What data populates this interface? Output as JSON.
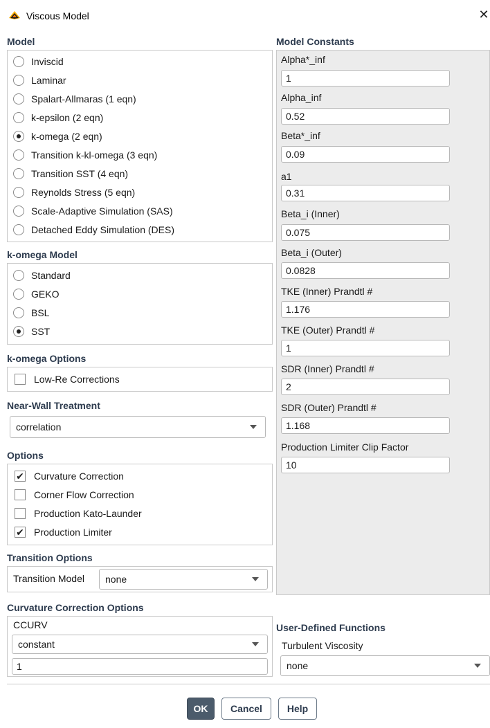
{
  "window": {
    "title": "Viscous Model",
    "close_symbol": "✕",
    "app_icon": "fluent-app-icon"
  },
  "model": {
    "heading": "Model",
    "options": [
      {
        "label": "Inviscid",
        "selected": false
      },
      {
        "label": "Laminar",
        "selected": false
      },
      {
        "label": "Spalart-Allmaras (1 eqn)",
        "selected": false
      },
      {
        "label": "k-epsilon (2 eqn)",
        "selected": false
      },
      {
        "label": "k-omega (2 eqn)",
        "selected": true
      },
      {
        "label": "Transition k-kl-omega (3 eqn)",
        "selected": false
      },
      {
        "label": "Transition SST (4 eqn)",
        "selected": false
      },
      {
        "label": "Reynolds Stress (5 eqn)",
        "selected": false
      },
      {
        "label": "Scale-Adaptive Simulation (SAS)",
        "selected": false
      },
      {
        "label": "Detached Eddy Simulation (DES)",
        "selected": false
      }
    ]
  },
  "komega_model": {
    "heading": "k-omega Model",
    "options": [
      {
        "label": "Standard",
        "selected": false
      },
      {
        "label": "GEKO",
        "selected": false
      },
      {
        "label": "BSL",
        "selected": false
      },
      {
        "label": "SST",
        "selected": true
      }
    ]
  },
  "komega_options": {
    "heading": "k-omega Options",
    "low_re": {
      "label": "Low-Re Corrections",
      "checked": false
    }
  },
  "near_wall": {
    "heading": "Near-Wall Treatment",
    "selected": "correlation"
  },
  "options": {
    "heading": "Options",
    "items": [
      {
        "label": "Curvature Correction",
        "checked": true
      },
      {
        "label": "Corner Flow Correction",
        "checked": false
      },
      {
        "label": "Production Kato-Launder",
        "checked": false
      },
      {
        "label": "Production Limiter",
        "checked": true
      }
    ]
  },
  "transition_options": {
    "heading": "Transition Options",
    "model_label": "Transition Model",
    "model_value": "none"
  },
  "curvature_options": {
    "heading": "Curvature Correction Options",
    "ccurv_label": "CCURV",
    "ccurv_mode": "constant",
    "ccurv_value": "1"
  },
  "model_constants": {
    "heading": "Model Constants",
    "items": [
      {
        "label": "Alpha*_inf",
        "value": "1"
      },
      {
        "label": "Alpha_inf",
        "value": "0.52"
      },
      {
        "label": "Beta*_inf",
        "value": "0.09"
      },
      {
        "label": "a1",
        "value": "0.31"
      },
      {
        "label": "Beta_i (Inner)",
        "value": "0.075"
      },
      {
        "label": "Beta_i (Outer)",
        "value": "0.0828"
      },
      {
        "label": "TKE (Inner) Prandtl #",
        "value": "1.176"
      },
      {
        "label": "TKE (Outer) Prandtl #",
        "value": "1"
      },
      {
        "label": "SDR (Inner) Prandtl #",
        "value": "2"
      },
      {
        "label": "SDR (Outer) Prandtl #",
        "value": "1.168"
      },
      {
        "label": "Production Limiter Clip Factor",
        "value": "10"
      }
    ]
  },
  "udf": {
    "heading": "User-Defined Functions",
    "turbulent_viscosity_label": "Turbulent Viscosity",
    "turbulent_viscosity_value": "none"
  },
  "buttons": {
    "ok": "OK",
    "cancel": "Cancel",
    "help": "Help"
  },
  "colors": {
    "heading": "#2d3b4e",
    "primary_button": "#4b5b6b",
    "panel_bg": "#ececec",
    "border": "#c9c9c9"
  }
}
